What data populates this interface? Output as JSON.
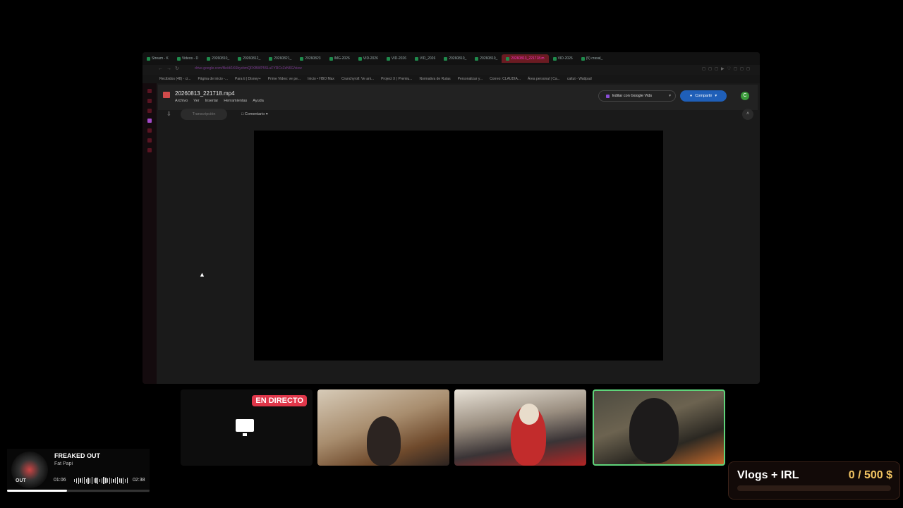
{
  "browser": {
    "tabs": [
      {
        "label": "Stream - K"
      },
      {
        "label": "Videos - D"
      },
      {
        "label": "20260810_"
      },
      {
        "label": "20260812_"
      },
      {
        "label": "20260821_"
      },
      {
        "label": "20260823"
      },
      {
        "label": "IMG-2026"
      },
      {
        "label": "VID-2026"
      },
      {
        "label": "VID-2026"
      },
      {
        "label": "VID_2026"
      },
      {
        "label": "20260810_"
      },
      {
        "label": "20260810_"
      },
      {
        "label": "20260813_221718.m"
      },
      {
        "label": "VID-2026"
      },
      {
        "label": "(5) crasal_"
      }
    ],
    "url": "drive.google.com/file/d/1K6bycbmQFKBWP5SLuFYRCcZzN6G/view",
    "bookmarks": [
      "Recibidos (48) - ci...",
      "Página de inicio -...",
      "Para ti | Disney+",
      "Prime Video: ve pe...",
      "Inicio • HBO Max",
      "Crunchyroll: Ve ani...",
      "Project X | Premiu...",
      "Normativa de Rutas",
      "Personalizar y...",
      "Correo: CLAUDIA...",
      "Área personal | Ca...",
      "caltut - Wattpad"
    ]
  },
  "drive": {
    "file_title": "20260813_221718.mp4",
    "menu": [
      "Archivo",
      "Ver",
      "Insertar",
      "Herramientas",
      "Ayuda"
    ],
    "edit_vids_label": "Editar con Google Vids",
    "share_label": "Compartir",
    "avatar_letter": "C",
    "transcript_label": "Transcripción",
    "comment_label": "Comentario"
  },
  "stream": {
    "live_badge": "EN DIRECTO"
  },
  "music": {
    "title": "FREAKED OUT",
    "artist": "Fat Papi",
    "album_text": "OUT",
    "elapsed": "01:06",
    "duration": "02:38",
    "progress_fraction": 0.42
  },
  "goal": {
    "title": "Vlogs + IRL",
    "amount": "0 / 500 $",
    "progress_fraction": 0
  }
}
